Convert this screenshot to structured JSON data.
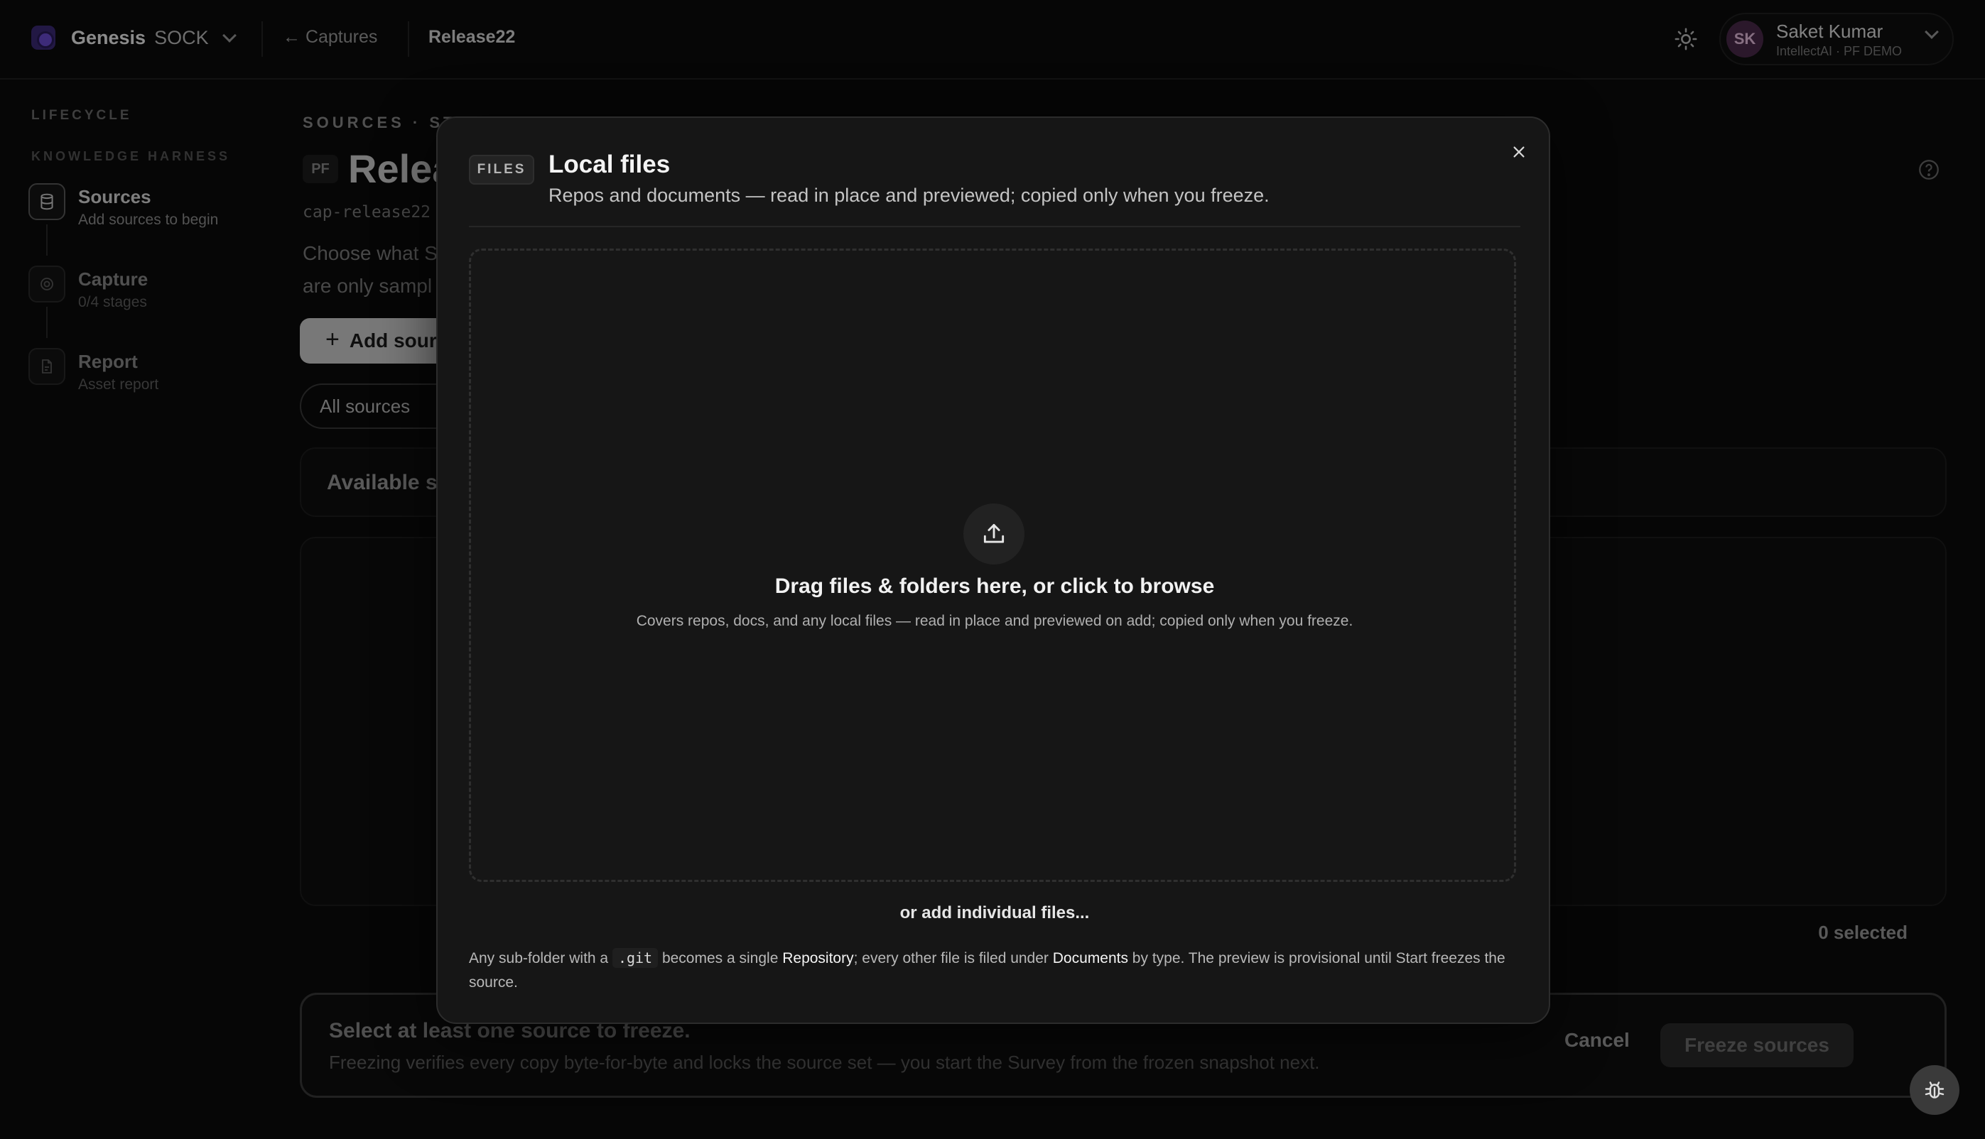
{
  "topbar": {
    "brand_name": "Genesis",
    "brand_sub": "SOCK",
    "back_link": "← Captures",
    "crumb": "Release22",
    "user_initials": "SK",
    "user_name": "Saket Kumar",
    "user_org": "IntellectAI · PF DEMO"
  },
  "sidebar": {
    "section_label": "LIFECYCLE",
    "group_label": "KNOWLEDGE HARNESS",
    "steps": [
      {
        "title": "Sources",
        "sub": "Add sources to begin"
      },
      {
        "title": "Capture",
        "sub": "0/4 stages"
      },
      {
        "title": "Report",
        "sub": "Asset report"
      }
    ]
  },
  "main": {
    "eyebrow": "SOURCES · STA",
    "pf_badge": "PF",
    "title": "Relea",
    "capture_id": "cap-release22",
    "description_line1": "Choose what S",
    "description_line2": "are only sampl",
    "add_source_label": "Add sour",
    "filter_label": "All sources",
    "available_title": "Available s",
    "selected_count": "0 selected"
  },
  "freeze_bar": {
    "title": "Select at least one source to freeze.",
    "subtitle": "Freezing verifies every copy byte-for-byte and locks the source set — you start the Survey from the frozen snapshot next.",
    "cancel_label": "Cancel",
    "freeze_label": "Freeze sources"
  },
  "modal": {
    "badge": "FILES",
    "title": "Local files",
    "subtitle": "Repos and documents — read in place and previewed; copied only when you freeze.",
    "drop_title": "Drag files & folders here, or click to browse",
    "drop_subtitle": "Covers repos, docs, and any local files — read in place and previewed on add; copied only when you freeze.",
    "add_individual": "or add individual files...",
    "note_part1": "Any sub-folder with a ",
    "note_code": ".git",
    "note_part2": " becomes a single ",
    "note_repo": "Repository",
    "note_part3": "; every other file is filed under ",
    "note_docs": "Documents",
    "note_part4": " by type. The preview is provisional until Start freezes the source."
  },
  "colors": {
    "background": "#0b0b0b",
    "modal": "#161616",
    "accent_logo": "#6a4ad0"
  }
}
